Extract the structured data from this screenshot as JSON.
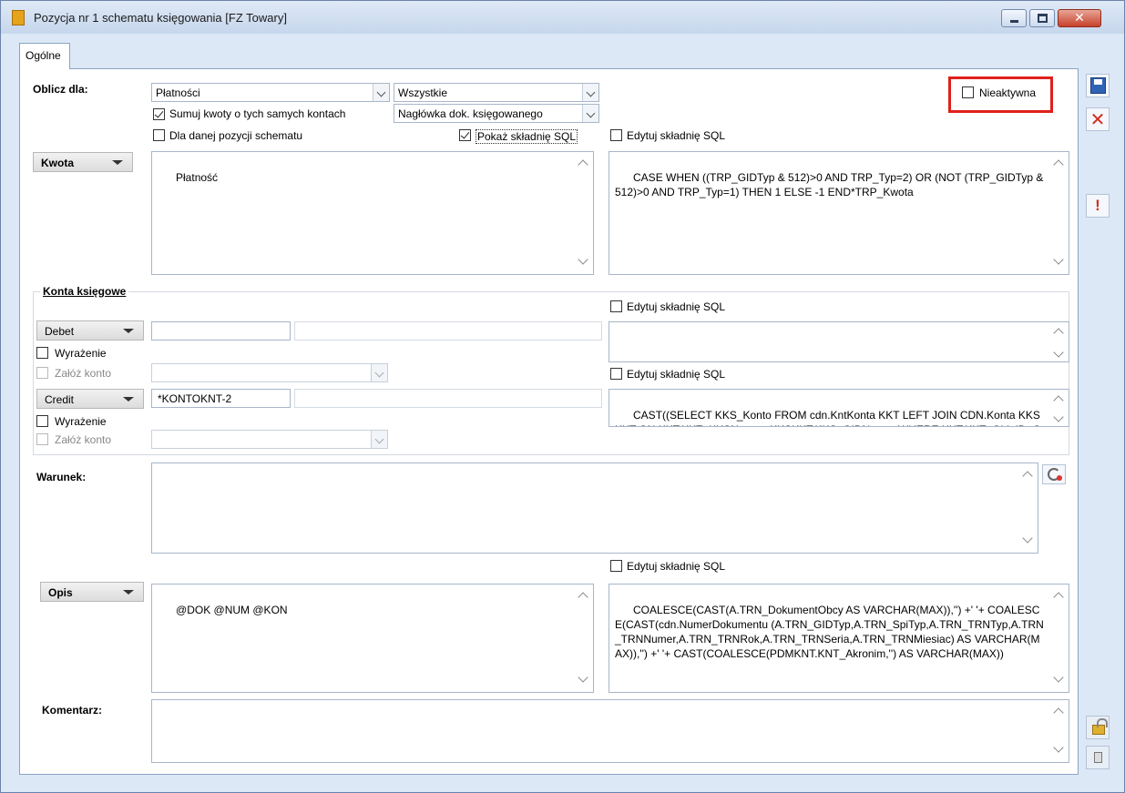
{
  "window": {
    "title": "Pozycja nr 1 schematu księgowania [FZ Towary]",
    "minimize_glyph": "",
    "close_glyph": "✕"
  },
  "tabs": [
    {
      "label": "Ogólne",
      "active": true
    }
  ],
  "oblicz": {
    "label": "Oblicz dla:",
    "combo1": "Płatności",
    "combo2": "Wszystkie",
    "combo3": "Nagłówka dok. księgowanego",
    "sumuj_label": "Sumuj kwoty o tych samych kontach",
    "sumuj_checked": true,
    "dla_danej_label": "Dla danej pozycji schematu",
    "dla_danej_checked": false,
    "pokaz_sql_label": "Pokaż składnię SQL",
    "pokaz_sql_checked": true,
    "edytuj_sql_label": "Edytuj składnię SQL",
    "nieaktywna_label": "Nieaktywna",
    "nieaktywna_checked": false
  },
  "kwota": {
    "button_label": "Kwota",
    "text": "Płatność",
    "sql": "CASE WHEN ((TRP_GIDTyp & 512)>0 AND TRP_Typ=2) OR (NOT (TRP_GIDTyp & 512)>0 AND TRP_Typ=1) THEN 1 ELSE -1 END*TRP_Kwota"
  },
  "konta": {
    "group_label": "Konta księgowe",
    "edytuj_sql_label": "Edytuj składnię SQL",
    "debet": {
      "button_label": "Debet",
      "input1": "",
      "input2": "",
      "sql": "",
      "wyrazenie_label": "Wyrażenie",
      "zaloz_label": "Załóż konto",
      "combo": ""
    },
    "credit": {
      "button_label": "Credit",
      "input1": "*KONTOKNT-2",
      "input2": "",
      "edytuj_sql_label": "Edytuj składnię SQL",
      "sql": "CAST((SELECT KKS_Konto FROM cdn.KntKonta KKT LEFT JOIN CDN.Konta KKSKKT ON KKT.KKT_KKSNumer=KKSKKT.KKS_GIDNumer WHERE KKT.KKT_ObiaID=ObiaID and KKT.KKT_KntTyp=KntTyp and",
      "wyrazenie_label": "Wyrażenie",
      "zaloz_label": "Załóż konto",
      "combo": ""
    }
  },
  "warunek": {
    "label": "Warunek:",
    "text": "",
    "edytuj_sql_label": "Edytuj składnię SQL"
  },
  "opis": {
    "button_label": "Opis",
    "text": "@DOK @NUM @KON",
    "sql": "COALESCE(CAST(A.TRN_DokumentObcy AS VARCHAR(MAX)),'') +' '+ COALESCE(CAST(cdn.NumerDokumentu (A.TRN_GIDTyp,A.TRN_SpiTyp,A.TRN_TRNTyp,A.TRN_TRNNumer,A.TRN_TRNRok,A.TRN_TRNSeria,A.TRN_TRNMiesiac) AS VARCHAR(MAX)),'') +' '+ CAST(COALESCE(PDMKNT.KNT_Akronim,'') AS VARCHAR(MAX))"
  },
  "komentarz": {
    "label": "Komentarz:",
    "text": ""
  },
  "sidebar": {
    "save_icon": "save-icon",
    "cancel_icon": "close-icon",
    "warn_glyph": "!",
    "lock_icon": "lock-icon",
    "pin_icon": "pin-icon"
  },
  "colors": {
    "highlight": "#e0201b",
    "window_bg": "#dde8f6",
    "panel_bg": "#ffffff"
  }
}
